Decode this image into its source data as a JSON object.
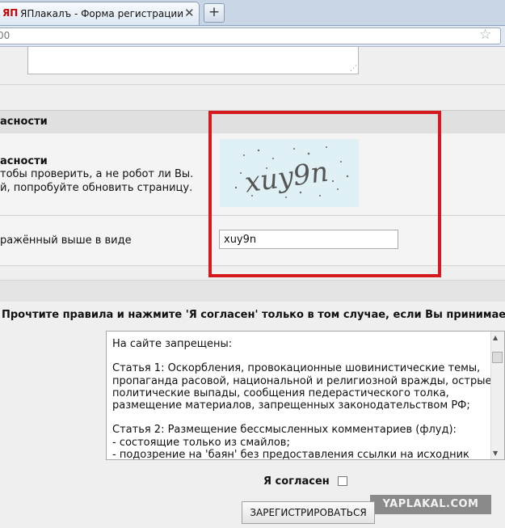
{
  "browser": {
    "favicon": "ЯП",
    "tab_title": "ЯПлакалъ - Форма регистрации",
    "tab_close": "✕",
    "new_tab": "+",
    "url_fragment": "00"
  },
  "security": {
    "section_header": "асности",
    "title": "асности",
    "desc_line1": "тобы проверить, а не робот ли Вы.",
    "desc_line2": "й, попробуйте обновить страницу.",
    "captcha_text": "xuy9n",
    "input_label": "ражённый выше в виде",
    "input_value": "xuy9n"
  },
  "rules": {
    "heading": "Прочтите правила и нажмите 'Я согласен' только в том случае, если Вы принимаете",
    "text": "На сайте запрещены:\n\nСтатья 1: Оскорбления, провокационные шовинистические темы, пропаганда расовой, национальной и религиозной вражды, острые политические выпады, сообщения педерастического толка, размещение материалов, запрещенных законодательством РФ;\n\nСтатья 2: Размещение бессмысленных комментариев (флуд):\n- состоящие только из смайлов;\n- подозрение на 'баян' без предоставления ссылки на исходник (баян,"
  },
  "form": {
    "agree_label": "Я согласен",
    "submit_label": "ЗАРЕГИСТРИРОВАТЬСЯ"
  },
  "watermark": "YAPLAKAL.COM",
  "colors": {
    "highlight": "#d6191f",
    "captcha_bg": "#dff1f5"
  }
}
